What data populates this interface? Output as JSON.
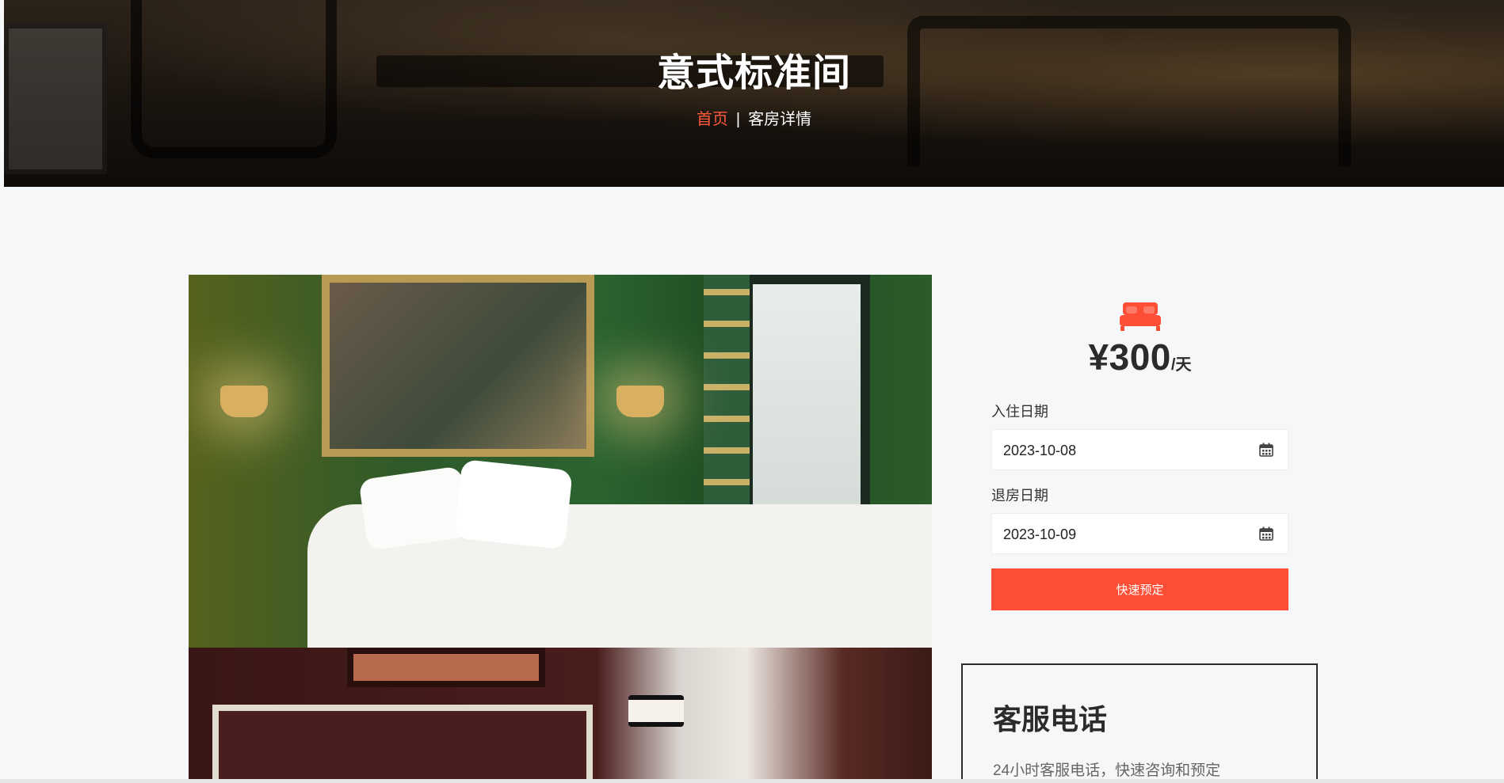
{
  "hero": {
    "title": "意式标准间",
    "breadcrumb": {
      "home": "首页",
      "separator": "|",
      "current": "客房详情"
    }
  },
  "booking": {
    "icon": "bed-icon",
    "price": "¥300",
    "unit": "/天",
    "checkin_label": "入住日期",
    "checkin_value": "2023-10-08",
    "checkout_label": "退房日期",
    "checkout_value": "2023-10-09",
    "submit_label": "快速预定",
    "accent_color": "#ff4e36"
  },
  "service": {
    "title": "客服电话",
    "description": "24小时客服电话，快速咨询和预定"
  }
}
